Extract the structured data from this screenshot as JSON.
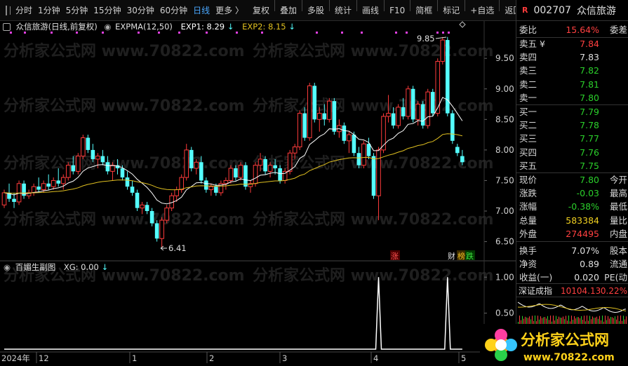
{
  "toolbar": {
    "items": [
      "分时",
      "1分钟",
      "5分钟",
      "15分钟",
      "30分钟",
      "60分钟",
      "日线",
      "更多 〉"
    ],
    "active": "日线",
    "tools": [
      "复权",
      "叠加",
      "多股",
      "统计",
      "画线",
      "F10",
      "简框",
      "标记",
      "+自选",
      "返回"
    ]
  },
  "info": {
    "stock_label": "众信旅游(日线,前复权)",
    "indicator": "EXPMA(12,50)",
    "exp1": "EXP1: 8.29",
    "exp2": "EXP2: 8.15"
  },
  "sub_info": {
    "name": "百媚生副图",
    "xg": "XG: 0.00"
  },
  "watermark": "分析家公式网 www.70822.com",
  "markers": {
    "high": "9.85",
    "low": "6.41",
    "zhang": "涨",
    "cai": "财",
    "bang": "榜",
    "die": "跌"
  },
  "axis": {
    "price_ticks": [
      "9.50",
      "9.00",
      "8.50",
      "8.00",
      "7.50",
      "7.00",
      "6.50"
    ],
    "sub_ticks": [
      "1.00",
      "0.50"
    ],
    "date_labels": [
      "2024年",
      "12",
      "1",
      "2",
      "3",
      "4",
      "5"
    ]
  },
  "quote": {
    "code": "002707",
    "name": "众信旅游",
    "badge": "R",
    "webi_label": "委比",
    "webi": "15.64%",
    "weicha_label": "委差",
    "sell": [
      {
        "label": "卖五 ¥",
        "price": "7.84"
      },
      {
        "label": "卖四",
        "price": "7.83"
      },
      {
        "label": "卖三",
        "price": "7.82"
      },
      {
        "label": "卖二",
        "price": "7.81"
      },
      {
        "label": "卖一",
        "price": "7.80"
      }
    ],
    "buy": [
      {
        "label": "买一",
        "price": "7.79"
      },
      {
        "label": "买二",
        "price": "7.78"
      },
      {
        "label": "买三",
        "price": "7.77"
      },
      {
        "label": "买四",
        "price": "7.76"
      },
      {
        "label": "买五",
        "price": "7.75"
      }
    ],
    "stats": [
      {
        "label": "现价",
        "value": "7.80",
        "right": "今开",
        "color": "green"
      },
      {
        "label": "涨跌",
        "value": "-0.03",
        "right": "最高",
        "color": "green"
      },
      {
        "label": "涨幅",
        "value": "-0.38%",
        "right": "最低",
        "color": "green"
      },
      {
        "label": "总量",
        "value": "583384",
        "right": "量比",
        "color": "yellow"
      },
      {
        "label": "外盘",
        "value": "274495",
        "right": "内盘",
        "color": "red"
      },
      {
        "label": "换手",
        "value": "7.07%",
        "right": "股本",
        "color": "white"
      },
      {
        "label": "净资",
        "value": "0.89",
        "right": "流通",
        "color": "white"
      },
      {
        "label": "收益(一)",
        "value": "0.020",
        "right": "PE(动",
        "color": "white"
      }
    ],
    "index_name": "深证成指",
    "index_value": "10104.13",
    "index_change": "0.22%"
  },
  "logo": {
    "text": "分析家公式网",
    "url": "www.70822.com"
  },
  "colors": {
    "up": "#ff3b3b",
    "down": "#54ffff",
    "exp1": "#ffffff",
    "exp2": "#e0c020",
    "accent": "#4aa8ff"
  },
  "chart_data": {
    "type": "candlestick",
    "ylim": [
      6.3,
      9.95
    ],
    "candles": [
      [
        7.1,
        7.35,
        7.05,
        7.3
      ],
      [
        7.3,
        7.45,
        7.15,
        7.2
      ],
      [
        7.2,
        7.3,
        7.05,
        7.15
      ],
      [
        7.15,
        7.5,
        7.1,
        7.45
      ],
      [
        7.45,
        7.5,
        7.2,
        7.25
      ],
      [
        7.25,
        7.35,
        7.2,
        7.3
      ],
      [
        7.3,
        7.45,
        7.25,
        7.4
      ],
      [
        7.4,
        7.55,
        7.3,
        7.35
      ],
      [
        7.35,
        7.5,
        7.3,
        7.45
      ],
      [
        7.45,
        7.6,
        7.35,
        7.4
      ],
      [
        7.4,
        7.55,
        7.35,
        7.5
      ],
      [
        7.5,
        7.7,
        7.4,
        7.45
      ],
      [
        7.45,
        7.6,
        7.35,
        7.55
      ],
      [
        7.55,
        7.8,
        7.5,
        7.75
      ],
      [
        7.75,
        7.9,
        7.6,
        7.65
      ],
      [
        7.65,
        7.95,
        7.6,
        7.9
      ],
      [
        7.9,
        8.25,
        7.85,
        8.2
      ],
      [
        8.2,
        8.25,
        7.95,
        8.0
      ],
      [
        8.0,
        8.1,
        7.8,
        7.85
      ],
      [
        7.85,
        7.95,
        7.7,
        7.9
      ],
      [
        7.9,
        8.0,
        7.75,
        7.8
      ],
      [
        7.8,
        7.9,
        7.6,
        7.65
      ],
      [
        7.65,
        7.8,
        7.5,
        7.75
      ],
      [
        7.75,
        7.85,
        7.6,
        7.7
      ],
      [
        7.7,
        7.75,
        7.5,
        7.55
      ],
      [
        7.55,
        7.65,
        7.35,
        7.4
      ],
      [
        7.4,
        7.5,
        7.25,
        7.3
      ],
      [
        7.3,
        7.35,
        7.0,
        7.05
      ],
      [
        7.05,
        7.15,
        6.95,
        7.1
      ],
      [
        7.1,
        7.15,
        6.95,
        7.0
      ],
      [
        7.0,
        7.05,
        6.75,
        6.8
      ],
      [
        6.8,
        6.85,
        6.5,
        6.55
      ],
      [
        6.55,
        6.9,
        6.41,
        6.85
      ],
      [
        6.85,
        7.1,
        6.8,
        7.05
      ],
      [
        7.05,
        7.3,
        7.0,
        7.25
      ],
      [
        7.25,
        7.4,
        7.15,
        7.35
      ],
      [
        7.35,
        7.6,
        7.3,
        7.55
      ],
      [
        7.55,
        8.1,
        7.5,
        8.0
      ],
      [
        8.0,
        8.05,
        7.65,
        7.7
      ],
      [
        7.7,
        7.85,
        7.6,
        7.8
      ],
      [
        7.8,
        7.9,
        7.45,
        7.5
      ],
      [
        7.5,
        7.55,
        7.3,
        7.35
      ],
      [
        7.35,
        7.45,
        7.25,
        7.4
      ],
      [
        7.4,
        7.45,
        7.25,
        7.3
      ],
      [
        7.3,
        7.5,
        7.25,
        7.45
      ],
      [
        7.45,
        7.55,
        7.35,
        7.5
      ],
      [
        7.5,
        7.75,
        7.45,
        7.7
      ],
      [
        7.7,
        7.75,
        7.5,
        7.55
      ],
      [
        7.55,
        7.8,
        7.5,
        7.75
      ],
      [
        7.75,
        7.8,
        7.35,
        7.4
      ],
      [
        7.4,
        7.5,
        7.3,
        7.45
      ],
      [
        7.45,
        7.8,
        7.4,
        7.75
      ],
      [
        7.75,
        7.95,
        7.65,
        7.85
      ],
      [
        7.85,
        7.9,
        7.6,
        7.65
      ],
      [
        7.65,
        7.8,
        7.55,
        7.75
      ],
      [
        7.75,
        7.85,
        7.6,
        7.7
      ],
      [
        7.7,
        7.75,
        7.45,
        7.5
      ],
      [
        7.5,
        7.7,
        7.45,
        7.65
      ],
      [
        7.65,
        8.0,
        7.6,
        7.95
      ],
      [
        7.95,
        8.1,
        7.85,
        8.05
      ],
      [
        8.05,
        8.65,
        8.0,
        8.6
      ],
      [
        8.6,
        8.7,
        8.15,
        8.2
      ],
      [
        8.2,
        9.1,
        8.15,
        9.05
      ],
      [
        9.05,
        9.1,
        8.45,
        8.5
      ],
      [
        8.5,
        8.7,
        8.3,
        8.6
      ],
      [
        8.6,
        8.75,
        8.4,
        8.5
      ],
      [
        8.5,
        8.85,
        8.45,
        8.8
      ],
      [
        8.8,
        8.85,
        8.25,
        8.3
      ],
      [
        8.3,
        8.5,
        8.2,
        8.4
      ],
      [
        8.4,
        8.45,
        8.1,
        8.15
      ],
      [
        8.15,
        8.3,
        7.95,
        8.25
      ],
      [
        8.25,
        8.3,
        7.9,
        7.95
      ],
      [
        7.95,
        8.05,
        7.7,
        7.75
      ],
      [
        7.75,
        8.15,
        7.7,
        8.1
      ],
      [
        8.1,
        8.2,
        7.85,
        7.9
      ],
      [
        7.9,
        7.95,
        7.2,
        7.25
      ],
      [
        7.25,
        8.05,
        6.85,
        8.0
      ],
      [
        8.0,
        8.6,
        7.95,
        8.55
      ],
      [
        8.55,
        8.9,
        8.45,
        8.6
      ],
      [
        8.6,
        8.7,
        8.35,
        8.4
      ],
      [
        8.4,
        8.75,
        8.35,
        8.7
      ],
      [
        8.7,
        8.85,
        8.5,
        8.55
      ],
      [
        8.55,
        9.05,
        8.5,
        9.0
      ],
      [
        9.0,
        9.05,
        8.45,
        8.5
      ],
      [
        8.5,
        8.8,
        8.4,
        8.75
      ],
      [
        8.75,
        8.8,
        8.35,
        8.4
      ],
      [
        8.4,
        9.0,
        8.35,
        8.95
      ],
      [
        8.95,
        9.0,
        8.55,
        8.6
      ],
      [
        8.6,
        9.5,
        8.55,
        9.45
      ],
      [
        9.45,
        9.85,
        9.4,
        9.8
      ],
      [
        9.8,
        9.85,
        8.55,
        8.6
      ],
      [
        8.6,
        8.65,
        8.1,
        8.15
      ],
      [
        8.05,
        8.1,
        7.9,
        7.95
      ],
      [
        7.9,
        8.0,
        7.75,
        7.8
      ]
    ],
    "xg_series": [
      {
        "name": "XG",
        "spikes": [
          {
            "index": 76,
            "value": 1.0
          },
          {
            "index": 90,
            "value": 1.0
          }
        ]
      }
    ]
  }
}
